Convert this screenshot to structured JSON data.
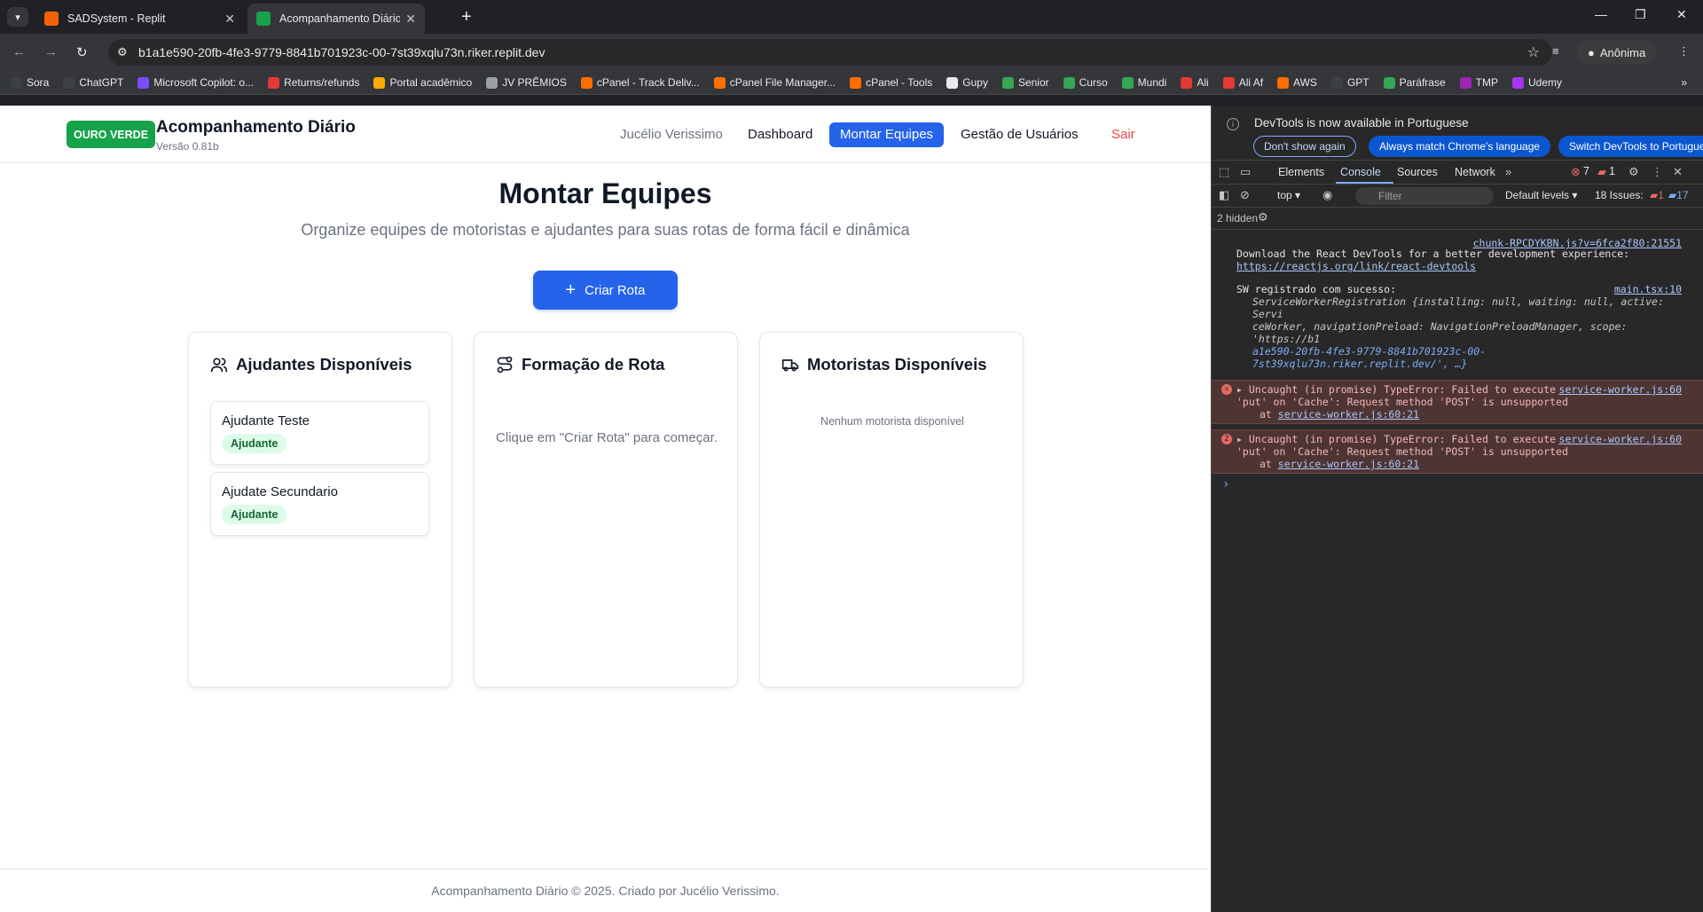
{
  "browser": {
    "tabs": [
      {
        "title": "SADSystem - Replit",
        "active": false
      },
      {
        "title": "Acompanhamento Diário - Our",
        "active": true
      }
    ],
    "url": "b1a1e590-20fb-4fe3-9779-8841b701923c-00-7st39xqlu73n.riker.replit.dev",
    "profile_label": "Anônima",
    "bookmarks": [
      "Sora",
      "ChatGPT",
      "Microsoft Copilot: o...",
      "Returns/refunds",
      "Portal acadêmico",
      "JV PRÊMIOS",
      "cPanel - Track Deliv...",
      "cPanel File Manager...",
      "cPanel - Tools",
      "Gupy",
      "Senior",
      "Curso",
      "Mundi",
      "Ali",
      "Ali Af",
      "AWS",
      "GPT",
      "Paráfrase",
      "TMP",
      "Udemy"
    ]
  },
  "app": {
    "brand_badge": "OURO VERDE",
    "title": "Acompanhamento Diário",
    "version": "Versão 0.81b",
    "nav": {
      "user": "Jucélio Verissimo",
      "dashboard": "Dashboard",
      "teams": "Montar Equipes",
      "users": "Gestão de Usuários",
      "logout": "Sair"
    },
    "page_title": "Montar Equipes",
    "page_subtitle": "Organize equipes de motoristas e ajudantes para suas rotas de forma fácil e dinâmica",
    "create_button": "Criar Rota",
    "cards": {
      "helpers": {
        "title": "Ajudantes Disponíveis",
        "people": [
          {
            "name": "Ajudante Teste",
            "role": "Ajudante"
          },
          {
            "name": "Ajudate Secundario",
            "role": "Ajudante"
          }
        ]
      },
      "route": {
        "title": "Formação de Rota",
        "empty": "Clique em \"Criar Rota\" para começar."
      },
      "drivers": {
        "title": "Motoristas Disponíveis",
        "empty": "Nenhum motorista disponível"
      }
    },
    "footer": "Acompanhamento Diário © 2025. Criado por Jucélio Verissimo."
  },
  "devtools": {
    "banner": "DevTools is now available in Portuguese",
    "btn_dont_show": "Don't show again",
    "btn_match": "Always match Chrome's language",
    "btn_switch": "Switch DevTools to Portuguese",
    "tabs": [
      "Elements",
      "Console",
      "Sources",
      "Network"
    ],
    "error_count": "7",
    "warn_count": "1",
    "context": "top",
    "filter_placeholder": "Filter",
    "levels": "Default levels",
    "issues_label": "18 Issues:",
    "issues_err": "1",
    "issues_info": "17",
    "hidden": "2 hidden",
    "logs": {
      "l1_src": "chunk-RPCDYKBN.js?v=6fca2f80:21551",
      "l1_text": "Download the React DevTools for a better development experience:",
      "l1_link": "https://reactjs.org/link/react-devtools",
      "l2_src": "main.tsx:10",
      "l2_text": "SW registrado com sucesso:",
      "l2_obj_a": "ServiceWorkerRegistration {installing: null, waiting: null, active: Servi",
      "l2_obj_b": "ceWorker, navigationPreload: NavigationPreloadManager, scope: 'https://b1",
      "l2_obj_c": "a1e590-20fb-4fe3-9779-8841b701923c-00-7st39xqlu73n.riker.replit.dev/', …}",
      "e1_src": "service-worker.js:60",
      "e1_a": "Uncaught (in promise) TypeError: Failed to execute",
      "e1_b": "'put' on 'Cache': Request method 'POST' is unsupported",
      "e1_at": "at",
      "e1_loc": "service-worker.js:60:21",
      "e2_badge": "2",
      "e2_src": "service-worker.js:60",
      "e2_a": "Uncaught (in promise) TypeError: Failed to execute",
      "e2_b": "'put' on 'Cache': Request method 'POST' is unsupported",
      "e2_at": "at",
      "e2_loc": "service-worker.js:60:21"
    }
  }
}
